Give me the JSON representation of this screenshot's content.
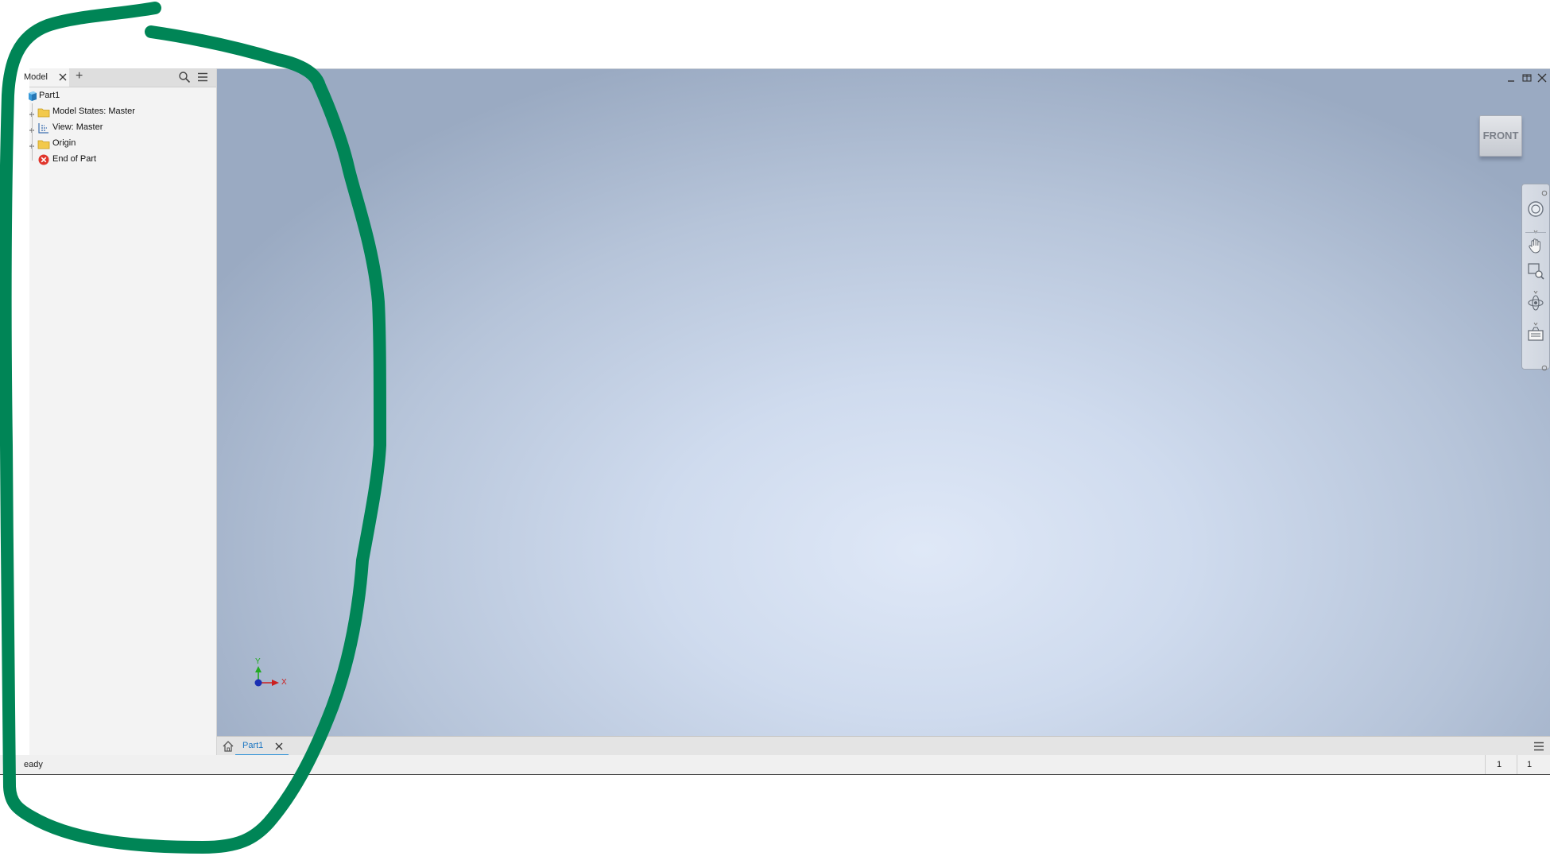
{
  "browser": {
    "tab_label": "Model",
    "add_tab_symbol": "+",
    "tree": [
      {
        "label": "Part1",
        "icon": "part-icon",
        "expandable": false
      },
      {
        "label": "Model States: Master",
        "icon": "folder-icon",
        "expandable": true
      },
      {
        "label": "View: Master",
        "icon": "view-rep-icon",
        "expandable": true
      },
      {
        "label": "Origin",
        "icon": "folder-icon",
        "expandable": true
      },
      {
        "label": "End of Part",
        "icon": "end-of-part-icon",
        "expandable": false
      }
    ]
  },
  "viewport": {
    "viewcube_face": "FRONT",
    "triad": {
      "x_label": "X",
      "y_label": "Y"
    },
    "window_controls": [
      "minimize-icon",
      "restore-icon",
      "close-icon"
    ],
    "navbar_tools": [
      "steering-wheel-icon",
      "pan-hand-icon",
      "zoom-window-icon",
      "orbit-icon",
      "look-at-icon"
    ]
  },
  "doc_tabs": {
    "active": "Part1"
  },
  "status": {
    "text": "eady",
    "field_1": "1",
    "field_2": "1"
  },
  "colors": {
    "accent": "#2b8fd6",
    "annotation": "#008556",
    "folder": "#f2c94c",
    "error": "#e0352b",
    "axis_x": "#cc1f1f",
    "axis_y": "#22aa22",
    "axis_origin": "#1a2fb3"
  }
}
